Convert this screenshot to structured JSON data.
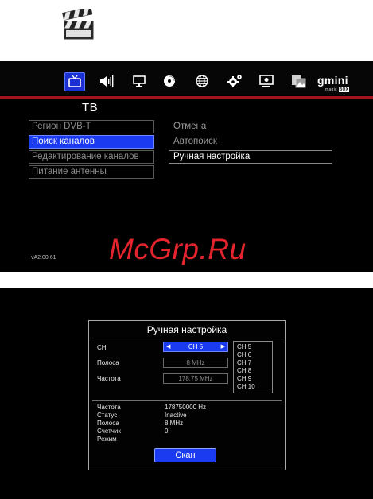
{
  "tv_menu": {
    "icons": [
      "tv-icon",
      "speaker-icon",
      "monitor-icon",
      "disc-icon",
      "globe-icon",
      "gears-icon",
      "screen-settings-icon",
      "photo-icon"
    ],
    "brand": "gmini",
    "brand_sub_prefix": "magic",
    "brand_sub_box": "BOX",
    "title": "ТВ",
    "items": [
      {
        "label": "Регион DVB-T"
      },
      {
        "label": "Поиск каналов"
      },
      {
        "label": "Редактирование каналов"
      },
      {
        "label": "Питание антенны"
      }
    ],
    "selected_index": 1,
    "submenu": [
      {
        "label": "Отмена"
      },
      {
        "label": "Автопоиск"
      },
      {
        "label": "Ручная настройка"
      }
    ],
    "version": "vA2.00.61"
  },
  "watermark": "McGrp.Ru",
  "manual_tuning": {
    "title": "Ручная настройка",
    "ch_label": "CH",
    "ch_value": "CH 5",
    "bandwidth_label": "Полоса",
    "bandwidth_value": "8 MHz",
    "frequency_label": "Частота",
    "frequency_value": "178.75 MHz",
    "channel_list": [
      "CH 5",
      "CH 6",
      "CH 7",
      "CH 8",
      "CH 9",
      "CH 10"
    ],
    "info": [
      {
        "label": "Частота",
        "value": "178750000 Hz"
      },
      {
        "label": "Статус",
        "value": "Inactive"
      },
      {
        "label": "Полоса",
        "value": "8 MHz"
      },
      {
        "label": "Счетчик",
        "value": "0"
      },
      {
        "label": "Режим",
        "value": ""
      }
    ],
    "scan_label": "Скан"
  },
  "colors": {
    "accent": "#1b3bf0",
    "divider": "#a4141c",
    "watermark": "#e4242c"
  }
}
